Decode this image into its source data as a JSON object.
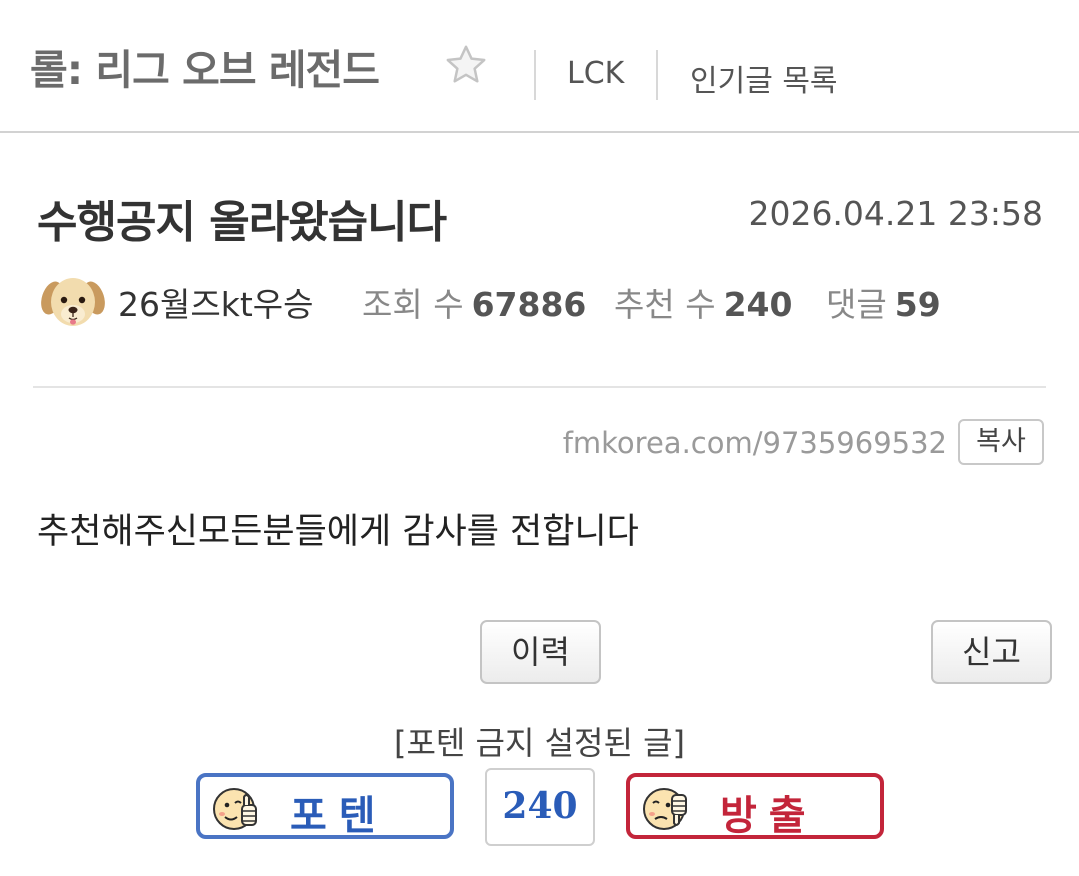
{
  "header": {
    "board_title": "롤: 리그 오브 레전드",
    "nav": [
      "LCK",
      "인기글 목록"
    ]
  },
  "post": {
    "title": "수행공지 올라왔습니다",
    "date": "2026.04.21 23:58",
    "author": "26월즈kt우승",
    "stats": {
      "views_label": "조회 수",
      "views": "67886",
      "recommend_label": "추천 수",
      "recommend": "240",
      "comments_label": "댓글",
      "comments": "59"
    },
    "url": "fmkorea.com/9735969532",
    "copy_label": "복사",
    "body": "추천해주신모든분들에게 감사를 전합니다"
  },
  "actions": {
    "history_label": "이력",
    "report_label": "신고"
  },
  "vote": {
    "notice": "[포텐 금지 설정된 글]",
    "up_label": "포텐",
    "count": "240",
    "down_label": "방출"
  },
  "colors": {
    "up_accent": "#4a74c4",
    "down_accent": "#c3253a",
    "count_text": "#2a5cb8"
  },
  "icons": {
    "favorite": "star-outline-icon",
    "avatar": "puppy-avatar",
    "up": "thumbs-up-face-icon",
    "down": "thumbs-down-face-icon"
  }
}
